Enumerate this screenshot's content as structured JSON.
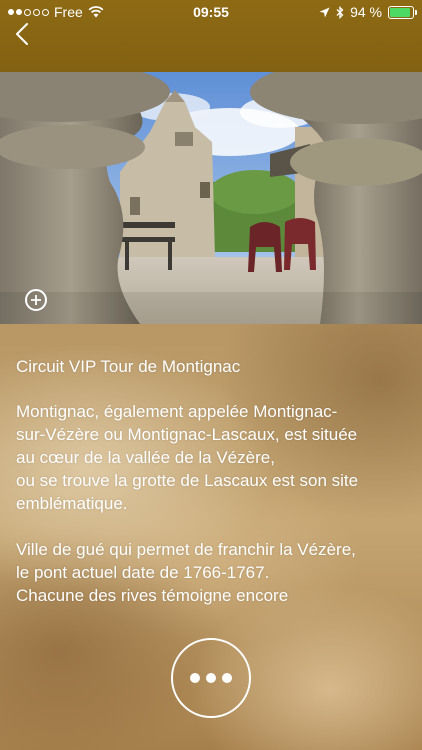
{
  "status_bar": {
    "carrier": "Free",
    "time": "09:55",
    "battery": "94 %",
    "battery_level": 0.94,
    "icons": [
      "signal-dots-icon",
      "wifi-icon",
      "location-arrow-icon",
      "bluetooth-icon",
      "battery-icon"
    ]
  },
  "nav": {
    "back_icon": "chevron-left-icon"
  },
  "photo": {
    "expand_icon": "plus-circle-icon"
  },
  "content": {
    "title": "Circuit VIP Tour de Montignac",
    "paragraph1": "Montignac, également appelée Montignac-\nsur-Vézère ou Montignac-Lascaux, est située\nau cœur de la vallée de la Vézère,\nou se trouve la grotte de Lascaux est son site\nemblématique.",
    "paragraph2": "Ville de gué qui permet de franchir la Vézère,\nle pont actuel date de 1766-1767.\nChacune des rives témoigne encore"
  },
  "more_button": {
    "icon": "ellipsis-icon"
  },
  "colors": {
    "topbar": "#8e6a14",
    "battery_fill": "#4cd964",
    "text": "#ffffff"
  }
}
